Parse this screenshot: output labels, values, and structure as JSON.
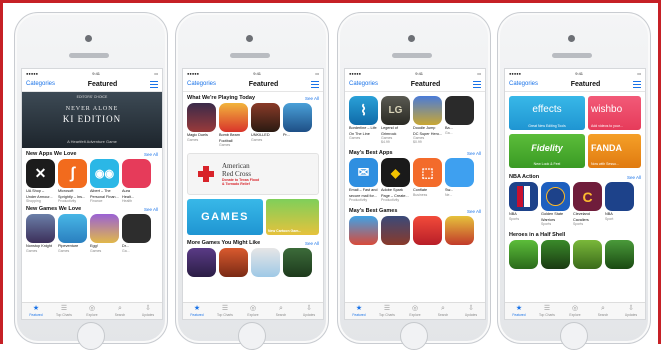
{
  "common": {
    "categories": "Categories",
    "featured": "Featured",
    "see_all": "See All",
    "tabs": [
      "Featured",
      "Top Charts",
      "Explore",
      "Search",
      "Updates"
    ],
    "accent": "#1a73e8",
    "border_color": "#c62026"
  },
  "phone1": {
    "editors_choice": "EDITORS' CHOICE",
    "hero_line1": "NEVER ALONE",
    "hero_line2": "KI EDITION",
    "hero_caption": "A Heartfelt Adventure Game",
    "section1": "New Apps We Love",
    "apps1": [
      {
        "name": "UA Shop –",
        "name2": "Under Armour...",
        "cat": "Shopping"
      },
      {
        "name": "Microsoft",
        "name2": "Sprightly – Ins...",
        "cat": "Productivity"
      },
      {
        "name": "Albert – The",
        "name2": "Personal Finan...",
        "cat": "Finance"
      },
      {
        "name": "Aura",
        "name2": "Healt...",
        "cat": "Health"
      }
    ],
    "section2": "New Games We Love",
    "apps2": [
      {
        "name": "Nonstop Knight",
        "cat": "Games"
      },
      {
        "name": "Pipeventure",
        "cat": "Games"
      },
      {
        "name": "Egg!",
        "cat": "Games"
      },
      {
        "name": "Dr...",
        "cat": "Ga..."
      }
    ]
  },
  "phone2": {
    "section1": "What We're Playing Today",
    "apps1": [
      {
        "name": "Magic Duels",
        "cat": "Games"
      },
      {
        "name": "Bomb Beam",
        "name2": "Football",
        "cat": "Games"
      },
      {
        "name": "UNKILLED",
        "cat": "Games"
      },
      {
        "name": "Pr...",
        "cat": ""
      }
    ],
    "redcross_title1": "American",
    "redcross_title2": "Red Cross",
    "redcross_sub1": "Donate to Texas Flood",
    "redcross_sub2": "& Tornado Relief",
    "games_banner": "GAMES",
    "sponsor_caption": "New Cartoon Gam...",
    "section2": "More Games You Might Like"
  },
  "phone3": {
    "apps1": [
      {
        "name": "Borderline – Life",
        "name2": "On The Line",
        "cat": "Games"
      },
      {
        "name": "Legend of",
        "name2": "Grimrock",
        "cat": "Games",
        "price": "$4.99"
      },
      {
        "name": "Doodle Jump",
        "name2": "DC Super Hero...",
        "cat": "Games",
        "price": "$0.99"
      },
      {
        "name": "Ba...",
        "cat": "Ga..."
      }
    ],
    "section1": "May's Best Apps",
    "apps2": [
      {
        "name": "Email – Fast and",
        "name2": "secure mail for...",
        "cat": "Productivity"
      },
      {
        "name": "Adobe Spark",
        "name2": "Page – Create...",
        "cat": "Productivity"
      },
      {
        "name": "Conflate",
        "cat": "Business"
      },
      {
        "name": "Sw...",
        "cat": "Ne..."
      }
    ],
    "section2": "May's Best Games"
  },
  "phone4": {
    "banner1": "effects",
    "banner1_sub": "Great New Editing Tools",
    "banner2": "wishbo",
    "banner2_sub": "Add videos to your...",
    "banner3": "Fidelity",
    "banner3_sub": "New Look & Feel",
    "banner4": "FANDA",
    "banner4_sub": "Now with Sesso...",
    "section1": "NBA Action",
    "apps1": [
      {
        "name": "NBA",
        "cat": "Sports"
      },
      {
        "name": "Golden State",
        "name2": "Warriors",
        "cat": "Sports"
      },
      {
        "name": "Cleveland",
        "name2": "Cavaliers",
        "cat": "Sports"
      },
      {
        "name": "NBA",
        "cat": "Sport"
      }
    ],
    "section2": "Heroes in a Half Shell"
  }
}
